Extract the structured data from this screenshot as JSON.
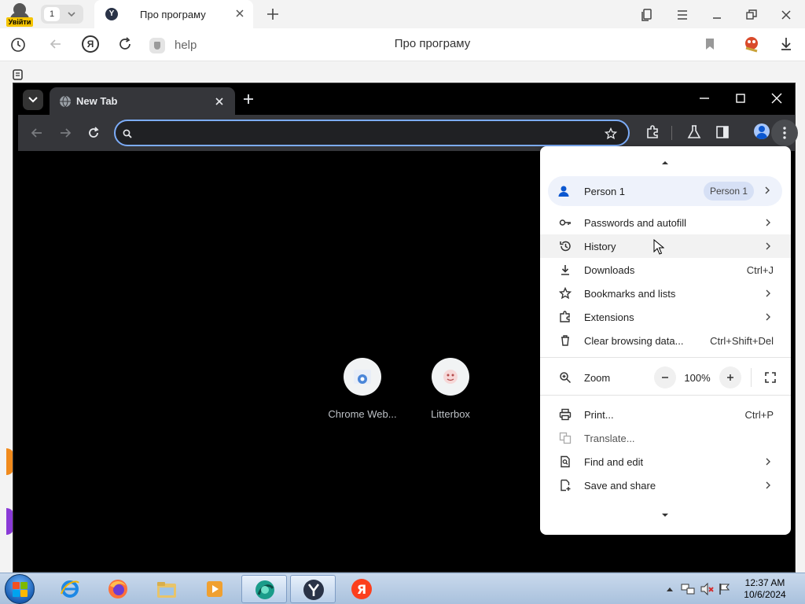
{
  "yandex": {
    "avatar_label": "Увійти",
    "tab_count": "1",
    "active_tab": {
      "title": "Про програму"
    },
    "address": {
      "site": "help",
      "page_title": "Про програму"
    }
  },
  "chrome": {
    "tab": {
      "title": "New Tab"
    },
    "omnibox": {
      "value": "",
      "placeholder": ""
    },
    "shortcuts": [
      {
        "label": "Chrome Web..."
      },
      {
        "label": "Litterbox"
      }
    ],
    "menu": {
      "profile": {
        "name": "Person 1",
        "chip": "Person 1"
      },
      "items": [
        {
          "label": "Passwords and autofill",
          "icon": "key-icon",
          "submenu": true
        },
        {
          "label": "History",
          "icon": "history-icon",
          "submenu": true,
          "highlighted": true
        },
        {
          "label": "Downloads",
          "icon": "download-icon",
          "shortcut": "Ctrl+J"
        },
        {
          "label": "Bookmarks and lists",
          "icon": "star-icon",
          "submenu": true
        },
        {
          "label": "Extensions",
          "icon": "puzzle-icon",
          "submenu": true
        },
        {
          "label": "Clear browsing data...",
          "icon": "trash-icon",
          "shortcut": "Ctrl+Shift+Del"
        }
      ],
      "zoom": {
        "label": "Zoom",
        "value": "100%",
        "minus": "−",
        "plus": "+"
      },
      "items2": [
        {
          "label": "Print...",
          "icon": "print-icon",
          "shortcut": "Ctrl+P"
        },
        {
          "label": "Translate...",
          "icon": "translate-icon",
          "disabled": true
        },
        {
          "label": "Find and edit",
          "icon": "find-icon",
          "submenu": true
        },
        {
          "label": "Save and share",
          "icon": "save-share-icon",
          "submenu": true
        }
      ]
    }
  },
  "taskbar": {
    "apps": [
      "internet-explorer",
      "firefox",
      "file-explorer",
      "media-player",
      "browser-app",
      "yandex-browser",
      "yandex-app"
    ],
    "clock": {
      "time": "12:37 AM",
      "date": "10/6/2024"
    }
  },
  "colors": {
    "chrome_accent": "#7cacf8",
    "yandex_yellow": "#f5c400",
    "yandex_red": "#fc3f1d"
  }
}
